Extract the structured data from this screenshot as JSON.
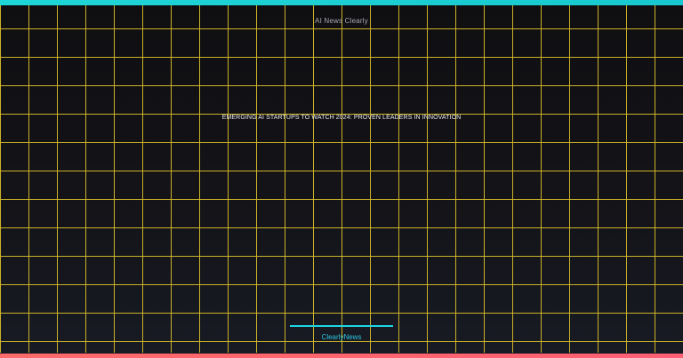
{
  "header": {
    "brand": "AI News Clearly"
  },
  "main": {
    "headline": "EMERGING AI STARTUPS TO WATCH 2024: PROVEN LEADERS IN INNOVATION"
  },
  "footer": {
    "label": "ClearlyNews"
  },
  "colors": {
    "top_bar": "#1fd6d6",
    "bottom_bar": "#ff6a6a",
    "grid": "#d6ba28",
    "accent": "#2cc5e0"
  }
}
